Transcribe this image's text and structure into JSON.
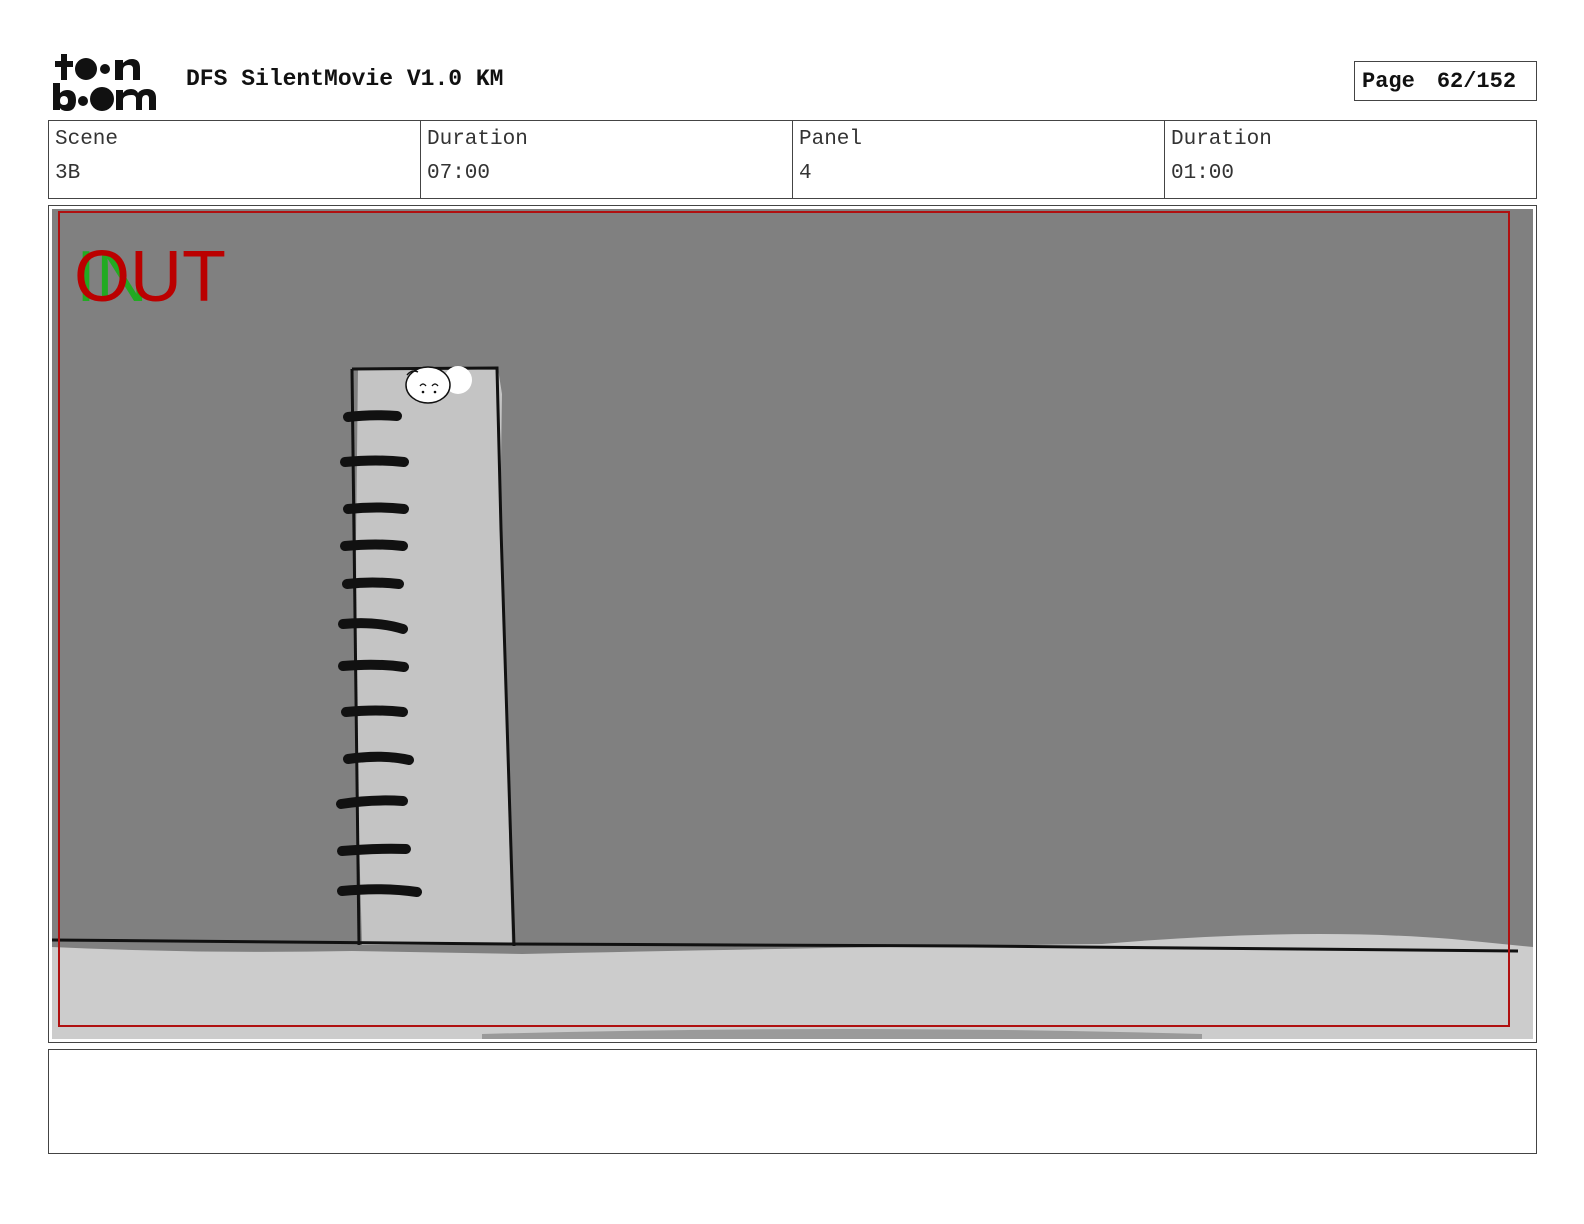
{
  "header": {
    "logo_text": "toonboom",
    "title": "DFS SilentMovie V1.0 KM",
    "page_label": "Page",
    "page_number": "62/152"
  },
  "info": {
    "scene_label": "Scene",
    "scene_value": "3B",
    "scene_duration_label": "Duration",
    "scene_duration_value": "07:00",
    "panel_label": "Panel",
    "panel_value": "4",
    "panel_duration_label": "Duration",
    "panel_duration_value": "01:00"
  },
  "panel": {
    "in_marker": "IN",
    "out_marker": "OUT",
    "colors": {
      "background": "#808080",
      "ground": "#cccccc",
      "column": "#c4c4c4",
      "safe_frame": "#b01010",
      "in_marker": "#22aa22",
      "out_marker": "#bb0000"
    }
  },
  "notes": {
    "text": ""
  }
}
